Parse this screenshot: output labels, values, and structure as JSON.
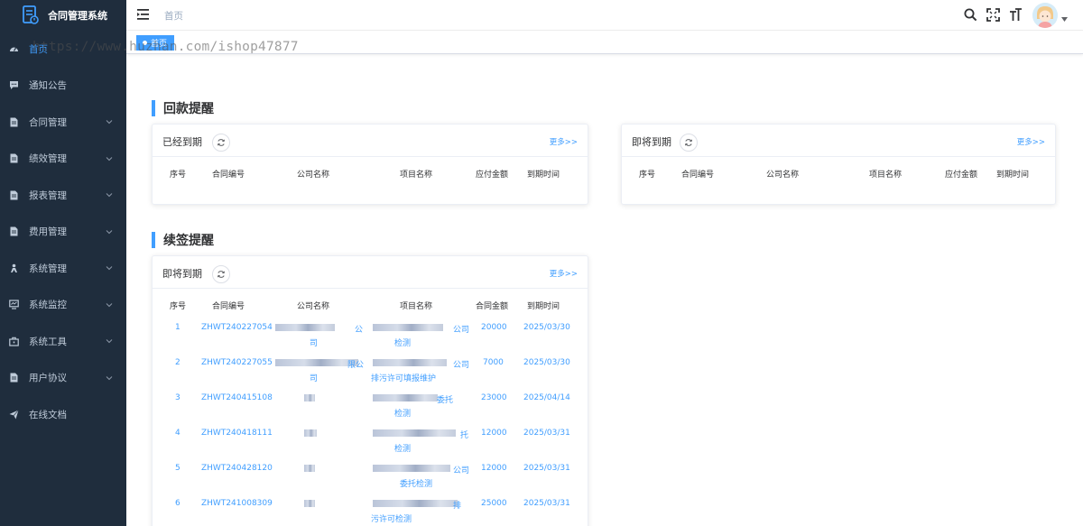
{
  "app": {
    "title": "合同管理系统"
  },
  "sidebar": {
    "items": [
      {
        "label": "首页",
        "icon": "dashboard-icon",
        "active": true,
        "expandable": false
      },
      {
        "label": "通知公告",
        "icon": "message-icon",
        "expandable": false
      },
      {
        "label": "合同管理",
        "icon": "document-icon",
        "expandable": true
      },
      {
        "label": "绩效管理",
        "icon": "document-icon",
        "expandable": true
      },
      {
        "label": "报表管理",
        "icon": "document-icon",
        "expandable": true
      },
      {
        "label": "费用管理",
        "icon": "document-icon",
        "expandable": true
      },
      {
        "label": "系统管理",
        "icon": "user-icon",
        "expandable": true
      },
      {
        "label": "系统监控",
        "icon": "monitor-icon",
        "expandable": true
      },
      {
        "label": "系统工具",
        "icon": "toolbox-icon",
        "expandable": true
      },
      {
        "label": "用户协议",
        "icon": "document-icon",
        "expandable": true
      },
      {
        "label": "在线文档",
        "icon": "send-icon",
        "expandable": false
      }
    ]
  },
  "header": {
    "breadcrumb": "首页"
  },
  "tags": {
    "home": "首页"
  },
  "watermark": "https://www.huzhan.com/ishop47877",
  "payment": {
    "title": "回款提醒",
    "expired": {
      "title": "已经到期",
      "more": "更多>>",
      "columns": [
        "序号",
        "合同编号",
        "公司名称",
        "项目名称",
        "应付金额",
        "到期时间"
      ]
    },
    "upcoming": {
      "title": "即将到期",
      "more": "更多>>",
      "columns": [
        "序号",
        "合同编号",
        "公司名称",
        "项目名称",
        "应付金额",
        "到期时间"
      ]
    }
  },
  "renewal": {
    "title": "续签提醒",
    "card": {
      "title": "即将到期",
      "more": "更多>>",
      "columns": [
        "序号",
        "合同编号",
        "公司名称",
        "项目名称",
        "合同金额",
        "到期时间"
      ],
      "rows": [
        {
          "no": "1",
          "code": "ZHWT240227054",
          "company": [
            "司",
            "公"
          ],
          "project": [
            "公司",
            "检测"
          ],
          "amount": "20000",
          "date": "2025/03/30"
        },
        {
          "no": "2",
          "code": "ZHWT240227055",
          "company": [
            "司",
            "限公"
          ],
          "project": [
            "公司",
            "排污许可填报维护"
          ],
          "amount": "7000",
          "date": "2025/03/30"
        },
        {
          "no": "3",
          "code": "ZHWT240415108",
          "company": [],
          "project": [
            "委托",
            "检测"
          ],
          "amount": "23000",
          "date": "2025/04/14"
        },
        {
          "no": "4",
          "code": "ZHWT240418111",
          "company": [],
          "project": [
            "托",
            "检测"
          ],
          "amount": "12000",
          "date": "2025/03/31"
        },
        {
          "no": "5",
          "code": "ZHWT240428120",
          "company": [],
          "project": [
            "公司",
            "委托检测"
          ],
          "amount": "12000",
          "date": "2025/03/31"
        },
        {
          "no": "6",
          "code": "ZHWT241008309",
          "company": [],
          "project": [
            "排",
            "污许可检测"
          ],
          "amount": "25000",
          "date": "2025/03/31"
        }
      ]
    }
  },
  "colors": {
    "sidebar_bg": "#1f2d3d",
    "accent": "#409eff",
    "menu_text": "#bfcbd9"
  }
}
